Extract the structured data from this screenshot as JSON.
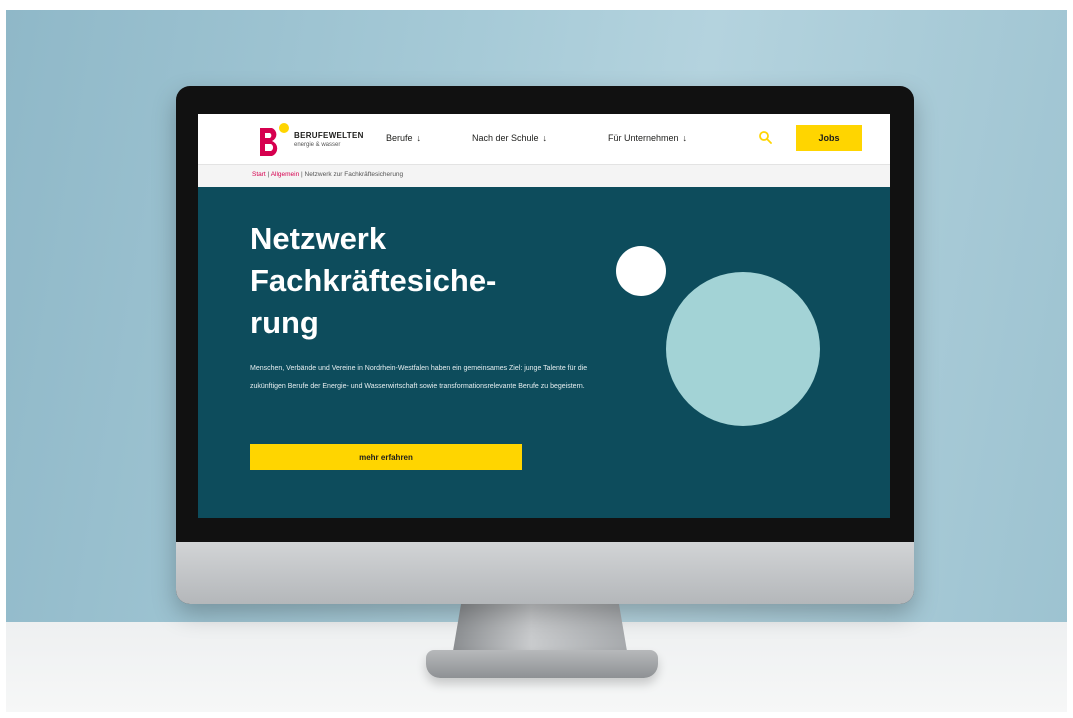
{
  "header": {
    "logo_name": "BERUFEWELTEN",
    "logo_tagline": "energie & wasser",
    "nav": [
      {
        "label": "Berufe"
      },
      {
        "label": "Nach der Schule"
      },
      {
        "label": "Für Unternehmen"
      }
    ],
    "jobs_label": "Jobs"
  },
  "breadcrumb": {
    "items": [
      "Start",
      "Allgemein",
      "Netzwerk zur Fachkräftesicherung"
    ],
    "separator": " | "
  },
  "hero": {
    "title": "Netzwerk\nFachkräftesiche-\nrung",
    "text": "Menschen, Verbände und Vereine in Nordrhein-Westfalen haben ein gemeinsames Ziel: junge Talente für die zukünftigen Berufe der Energie- und Wasserwirtschaft sowie transformationsrelevante Berufe zu begeistern.",
    "cta_label": "mehr erfahren"
  },
  "icons": {
    "search": "search-icon",
    "nav_arrow": "arrow-down-icon"
  },
  "colors": {
    "hero_bg": "#0d4c5c",
    "accent_yellow": "#ffd500",
    "brand_magenta": "#d6004f",
    "circle_teal": "#a3d3d6"
  }
}
